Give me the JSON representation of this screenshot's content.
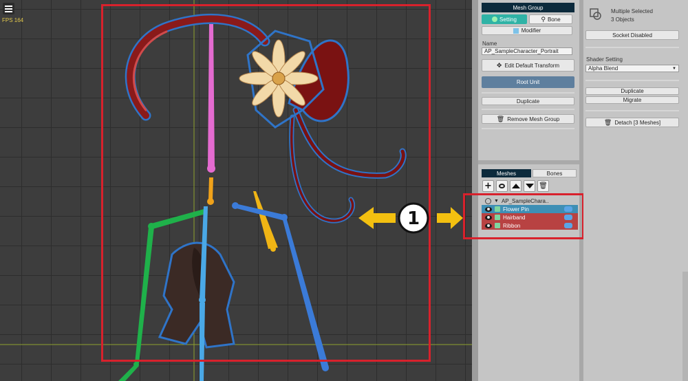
{
  "viewport": {
    "fps": "FPS 164",
    "callout_number": "1"
  },
  "mesh_group": {
    "header": "Mesh Group",
    "tab_setting": "Setting",
    "tab_bone": "Bone",
    "modifier_label": "Modifier",
    "name_label": "Name",
    "name_value": "AP_SampleCharacter_Portrait",
    "edit_default_transform": "Edit Default Transform",
    "root_unit": "Root Unit",
    "duplicate": "Duplicate",
    "remove_mesh_group": "Remove Mesh Group"
  },
  "meshes_panel": {
    "tab_meshes": "Meshes",
    "tab_bones": "Bones",
    "root_name": "AP_SampleChara..",
    "items": [
      {
        "label": "Flower Pin"
      },
      {
        "label": "Hairband"
      },
      {
        "label": "Ribbon"
      }
    ]
  },
  "inspector": {
    "title": "Multiple Selected",
    "subtitle": "3 Objects",
    "socket": "Socket Disabled",
    "shader_label": "Shader Setting",
    "shader_value": "Alpha Blend",
    "duplicate": "Duplicate",
    "migrate": "Migrate",
    "detach": "Detach [3 Meshes]"
  },
  "colors": {
    "accent_teal": "#2fb3a6",
    "header_navy": "#0c2a3c",
    "selected_row": "#3e8fb5",
    "highlight_row": "#b84242",
    "frame_red": "#d8212c",
    "arrow_yellow": "#f3c010"
  }
}
